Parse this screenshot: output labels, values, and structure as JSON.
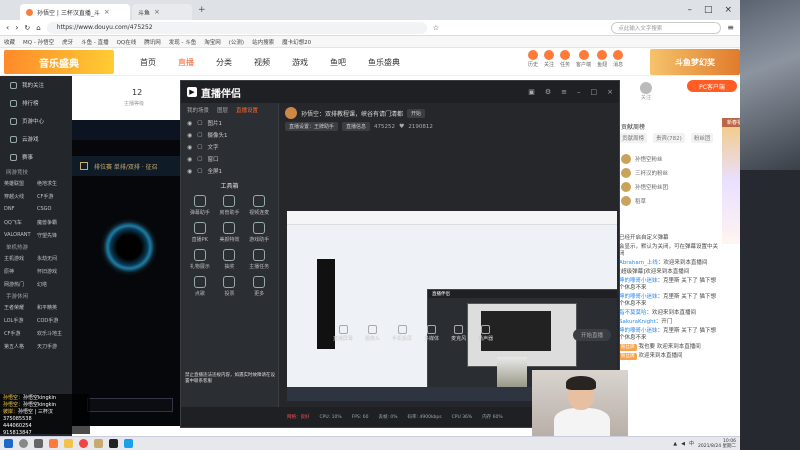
{
  "browser": {
    "tabs": [
      {
        "label": "孙悟空 | 三杯汉直播_斗",
        "active": true
      },
      {
        "label": "斗鱼",
        "active": false
      }
    ],
    "url": "https://www.douyu.com/475252",
    "search_placeholder": "点此输入文字搜索",
    "bookmarks": [
      "收藏",
      "MQ - 孙悟空",
      "虎牙",
      "斗鱼 - 直播",
      "QQ在线",
      "腾讯网",
      "发现 - 斗鱼",
      "淘宝网",
      "(公测)",
      "站内搜索",
      "魔卡幻想20"
    ]
  },
  "site": {
    "logo": "音乐盛典",
    "nav": [
      {
        "label": "首页",
        "active": false
      },
      {
        "label": "直播",
        "active": true
      },
      {
        "label": "分类",
        "active": false
      },
      {
        "label": "视频",
        "active": false
      },
      {
        "label": "游戏",
        "active": false
      },
      {
        "label": "鱼吧",
        "active": false
      },
      {
        "label": "鱼乐盛典",
        "active": false
      }
    ],
    "header_icons": [
      "历史",
      "关注",
      "任务",
      "客户端",
      "鱼翅",
      "消息"
    ],
    "banner": "斗鱼梦幻奖"
  },
  "sidebar": {
    "items": [
      "我的关注",
      "排行榜",
      "页游中心",
      "云游戏",
      "赛事"
    ],
    "section_online": "网游竞技",
    "online_games": [
      "英雄联盟",
      "绝地求生",
      "穿越火线",
      "CF手游",
      "DNF",
      "CSGO",
      "QQ飞车",
      "魔兽争霸",
      "VALORANT",
      "守望先锋"
    ],
    "section_mobile": "单机热游",
    "mobile_games": [
      "主机游戏",
      "永劫无间",
      "原神",
      "怀旧游戏",
      "网游热门",
      "幻塔"
    ],
    "section_lower": "手游休闲",
    "lower_games": [
      "王者荣耀",
      "和平精英",
      "LOL手游",
      "COD手游",
      "CF手游",
      "欢乐斗地主",
      "第五人格",
      "天刀手游"
    ]
  },
  "room": {
    "level": "12",
    "level_sub": "主播等级"
  },
  "right_panel": {
    "pc_button": "PC客户端",
    "fav_label": "关注",
    "tabs": [
      "贡献周榜",
      "贵宾(782)",
      "粉丝团"
    ],
    "rank_header": "贡献周榜",
    "ranks": [
      "孙悟空粉丝",
      "三杯汉的粉丝",
      "孙悟空粉丝团",
      "稻草"
    ],
    "chat": [
      {
        "user": "",
        "badge": "",
        "text": "已经开启自定义弹幕"
      },
      {
        "user": "",
        "badge": "",
        "text": "会显示，默认为关闭，可在弹幕设置中关闭"
      },
      {
        "user": "Abraham_上线",
        "badge": "",
        "text": "：欢迎来到本直播间"
      },
      {
        "user": "",
        "badge": "",
        "text": "[超级弹幕]欢迎来到本直播间"
      },
      {
        "user": "坤的嚎哥小迷妹",
        "badge": "",
        "text": "：克里斯 关下了 猫下想个休息不来"
      },
      {
        "user": "坤的嚎哥小迷妹",
        "badge": "",
        "text": "：克里斯 关下了 猫下想个休息不来"
      },
      {
        "user": "脂不莫莫哈",
        "badge": "",
        "text": "：欢迎来到本直播间"
      },
      {
        "user": "SakuraKnight",
        "badge": "",
        "text": "：开门"
      },
      {
        "user": "坤的嚎哥小迷妹",
        "badge": "",
        "text": "：克里斯 关下了 猫下想个休息不来"
      },
      {
        "user": "",
        "badge": "粉丝牌",
        "text": "我也要 欢迎来到本直播间"
      },
      {
        "user": "",
        "badge": "粉丝牌",
        "text": "欢迎来到本直播间"
      }
    ],
    "ad_title": "新春福利"
  },
  "game": {
    "title": "排位赛 单排/双排 · 征召",
    "button": "取消"
  },
  "obs": {
    "title": "直播伴侣",
    "left_tabs": [
      "我的场景",
      "图层",
      "直播设置"
    ],
    "layers": [
      "图片1",
      "摄像头1",
      "文字",
      "窗口",
      "全屏1"
    ],
    "tools_title": "工具箱",
    "tools": [
      "弹幕助手",
      "房管助手",
      "视频连麦",
      "直播PK",
      "美颜特效",
      "游戏助手",
      "礼物展示",
      "抽奖",
      "主播任务",
      "点歌",
      "投票",
      "更多"
    ],
    "warning": "禁止直播违法违规内容，如遇实时故障请在设置中联系客服",
    "streamer": "孙悟空：双排教程课，峡谷有请门清都",
    "stream_btn": "开始",
    "room_btns": [
      "直播设置：王牌助手",
      "直播信息"
    ],
    "room_id": "475252",
    "fans": "2190812",
    "bottom_tools": [
      "直播屏幕",
      "摄像头",
      "手机投屏",
      "多媒体",
      "麦克风",
      "扬声器"
    ],
    "start_label": "开始直播",
    "status": [
      {
        "label": "网络：良好",
        "red": true
      },
      {
        "label": "CPU: 10%",
        "red": false
      },
      {
        "label": "FPS: 60",
        "red": false
      },
      {
        "label": "丢帧: 0%",
        "red": false
      },
      {
        "label": "码率: 4900kbps",
        "red": false
      },
      {
        "label": "CPU 36%",
        "red": false
      },
      {
        "label": "内存 60%",
        "red": false
      }
    ]
  },
  "bottom_chat": {
    "lines": [
      {
        "user": "孙悟空",
        "text": "孙悟空kingkin"
      },
      {
        "user": "孙悟空",
        "text": "孙悟空kingkin"
      },
      {
        "user": "彼岸",
        "text": "孙悟空 | 三杯汉"
      }
    ],
    "numbers": [
      "375085538",
      "444060254",
      "915813847"
    ]
  },
  "taskbar": {
    "time": "10:06",
    "date": "2021/8/24 星期二",
    "lang": "中"
  }
}
